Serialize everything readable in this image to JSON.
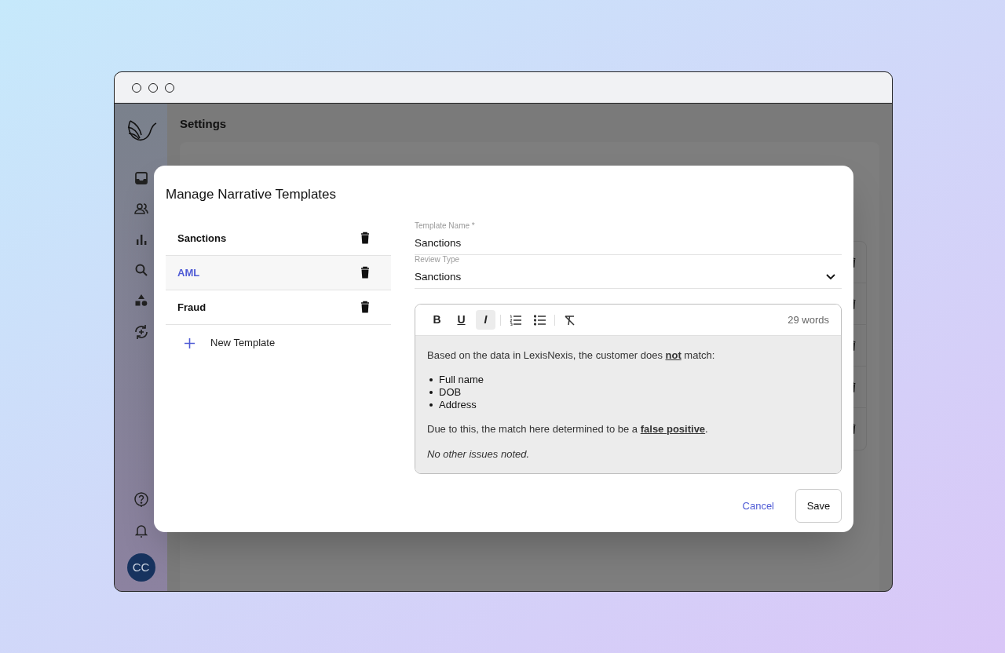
{
  "page": {
    "title": "Settings"
  },
  "sidebar": {
    "avatar": "CC"
  },
  "dialog": {
    "title": "Manage Narrative Templates",
    "templates": [
      {
        "label": "Sanctions",
        "selected": false
      },
      {
        "label": "AML",
        "selected": true
      },
      {
        "label": "Fraud",
        "selected": false
      }
    ],
    "new_template": "New Template",
    "fields": [
      {
        "kind": "text",
        "label": "Template Name *",
        "value": "Sanctions"
      },
      {
        "kind": "select",
        "label": "Review Type",
        "value": "Sanctions"
      }
    ],
    "editor": {
      "tools": [
        {
          "kind": "bold",
          "label": "B",
          "active": false
        },
        {
          "kind": "underline",
          "label": "U",
          "active": false
        },
        {
          "kind": "italic",
          "label": "I",
          "active": true
        },
        {
          "kind": "ordered-list",
          "active": false
        },
        {
          "kind": "bullet-list",
          "active": false
        },
        {
          "kind": "clear-format",
          "active": false
        }
      ],
      "word_count": "29 words",
      "blocks": [
        {
          "kind": "paragraph",
          "italic": false,
          "text": "Based on the data in LexisNexis, the customer does **not** match:"
        },
        {
          "kind": "list",
          "items": [
            "Full name",
            "DOB",
            "Address"
          ]
        },
        {
          "kind": "paragraph",
          "italic": false,
          "text": "Due to this, the match here determined to be a **false positive**."
        },
        {
          "kind": "paragraph",
          "italic": true,
          "text": "No other issues noted."
        }
      ]
    },
    "buttons": [
      {
        "kind": "link",
        "label": "Cancel"
      },
      {
        "kind": "outlined",
        "label": "Save"
      }
    ]
  }
}
